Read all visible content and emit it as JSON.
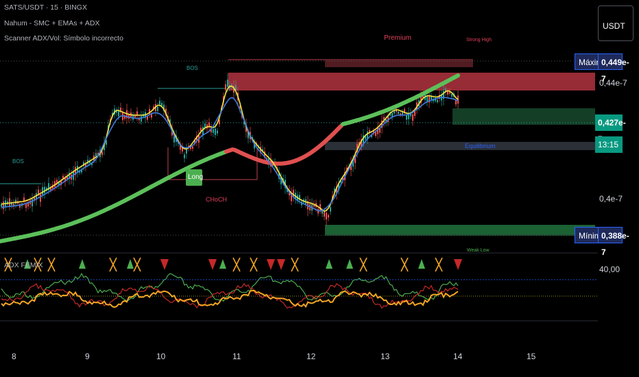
{
  "window": {
    "legend_symbol": "SATS/USDT · 15 · BINGX",
    "legend_indicator": "Nahum - SMC + EMAs + ADX",
    "legend_scanner": "Scanner ADX/Vol: Símbolo incorrecto",
    "currency_button": "USDT"
  },
  "price_scale": {
    "high_tag_label": "Máximo",
    "high_value": "0,449e-7",
    "level_1": "0,44e-7",
    "current_price": "0,427e-7",
    "countdown": "13:15",
    "level_2": "0,4e-7",
    "low_tag_label": "Mínimo",
    "low_value": "0,388e-7"
  },
  "smc_labels": {
    "premium": "Premium",
    "strong_high": "Strong High",
    "equilibrium": "Equilibrium",
    "weak_low": "Weak Low",
    "choch_main": "CHoCH",
    "bos_1": "BOS",
    "bos_2": "BOS",
    "long_signal": "Long"
  },
  "adx_pane": {
    "title": "ADX FEMIX",
    "level_value": "40,00"
  },
  "time_axis": [
    "8",
    "9",
    "10",
    "11",
    "12",
    "13",
    "14",
    "15"
  ],
  "colors": {
    "background": "#000000",
    "premium_zone": "#b2323f",
    "discount_zone": "#1e6b3a",
    "ema_yellow": "#f5e642",
    "ema_blue": "#3d7be0",
    "ema_slow_green": "#5cc05a",
    "ema_slow_red": "#e05050",
    "price_tag_teal": "#089981",
    "tag_navy": "#1f2a5a"
  }
}
